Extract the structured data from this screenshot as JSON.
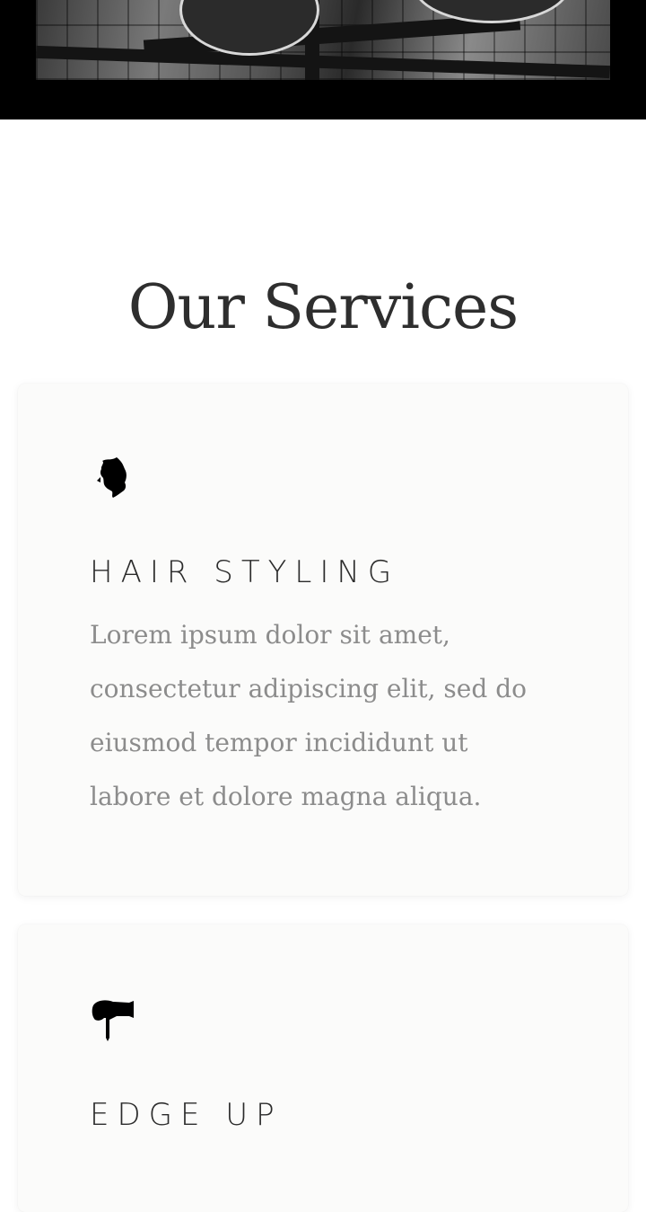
{
  "hero": {
    "image_alt": "black and white barber shop chairs on patterned tile floor"
  },
  "services": {
    "title": "Our Services",
    "items": [
      {
        "icon": "hair-head-icon",
        "heading": "HAIR STYLING",
        "text": "Lorem ipsum dolor sit amet, consectetur adipiscing elit, sed do eiusmod tempor incididunt ut labore et dolore magna aliqua."
      },
      {
        "icon": "hair-dryer-icon",
        "heading": "EDGE UP",
        "text": ""
      }
    ]
  },
  "colors": {
    "title": "#2e2e2e",
    "heading": "#2b2b2b",
    "body_text": "#8c8c8c",
    "card_bg": "#fbfbfa",
    "hero_bg": "#000000"
  }
}
